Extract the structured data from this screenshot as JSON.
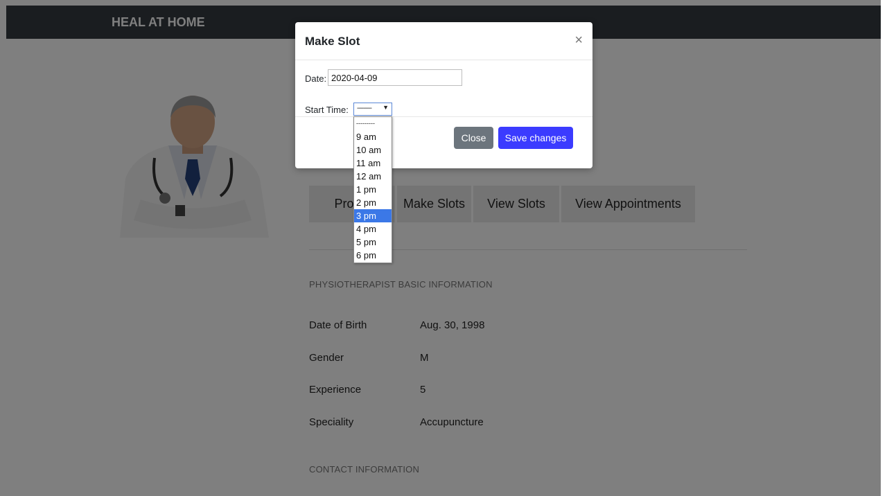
{
  "navbar": {
    "brand": "HEAL AT HOME"
  },
  "tabs": [
    {
      "label": "Profile"
    },
    {
      "label": "Make Slots"
    },
    {
      "label": "View Slots"
    },
    {
      "label": "View Appointments"
    }
  ],
  "basic_info": {
    "title": "PHYSIOTHERAPIST BASIC INFORMATION",
    "rows": [
      {
        "label": "Date of Birth",
        "value": "Aug. 30, 1998"
      },
      {
        "label": "Gender",
        "value": "M"
      },
      {
        "label": "Experience",
        "value": "5"
      },
      {
        "label": "Speciality",
        "value": "Accupuncture"
      }
    ]
  },
  "contact_info": {
    "title": "CONTACT INFORMATION"
  },
  "modal": {
    "title": "Make Slot",
    "close_symbol": "×",
    "date_label": "Date:",
    "date_value": "2020-04-09",
    "start_time_label": "Start Time:",
    "start_time_selected": "---------",
    "close_button": "Close",
    "save_button": "Save changes"
  },
  "dropdown": {
    "options": [
      "---------",
      "9 am",
      "10 am",
      "11 am",
      "12 am",
      "1 pm",
      "2 pm",
      "3 pm",
      "4 pm",
      "5 pm",
      "6 pm"
    ],
    "highlighted": "3 pm"
  },
  "colors": {
    "navbar": "#343a40",
    "primary": "#3b3bff",
    "secondary": "#6c757d",
    "highlight": "#3b78e7"
  }
}
